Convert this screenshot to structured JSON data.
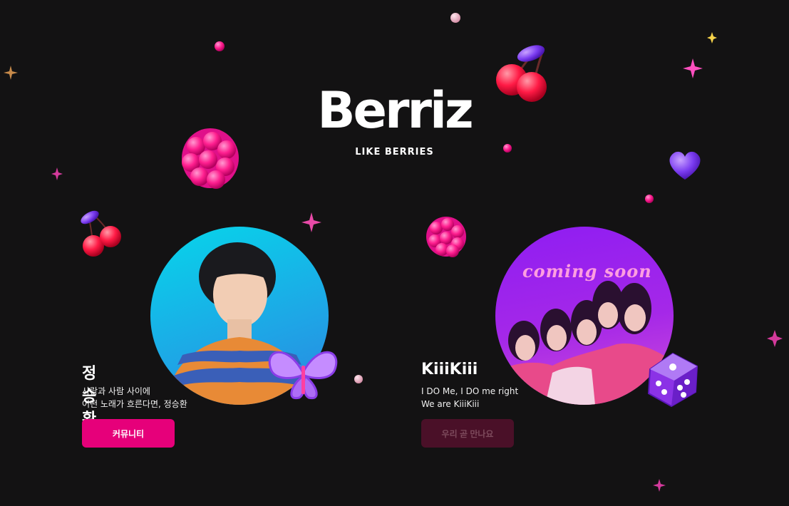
{
  "brand": {
    "logo_text": "Berriz",
    "tagline": "LIKE BERRIES",
    "accent": "#e6007a"
  },
  "artists": [
    {
      "name": "정승환",
      "description": "사람과 사람 사이에\n어떤 노래가 흐른다면, 정승환",
      "button_label": "커뮤니티",
      "button_state": "active",
      "avatar_bg": "#1fbfe6"
    },
    {
      "name": "KiiiKiii",
      "description": "I DO Me, I DO me right\nWe are KiiiKiii",
      "button_label": "우리 곧 만나요",
      "button_state": "disabled",
      "avatar_bg": "#8a1cf0",
      "overlay_text": "coming soon"
    }
  ],
  "decorations": [
    "cherry-icon",
    "raspberry-icon",
    "heart-icon",
    "butterfly-icon",
    "dice-icon",
    "sparkle-icon",
    "bead-icon"
  ]
}
